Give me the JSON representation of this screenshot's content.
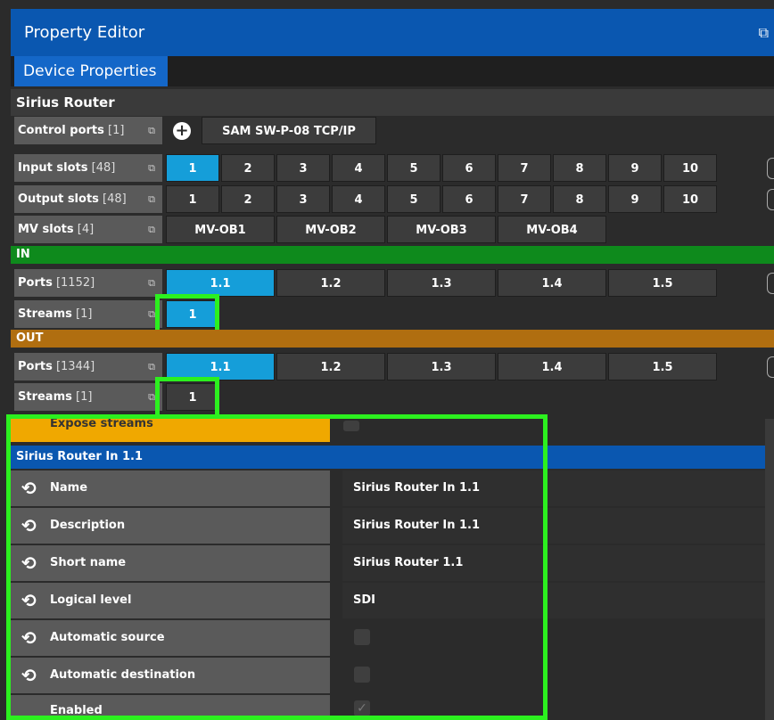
{
  "window": {
    "title": "Property Editor",
    "icon": "detach-icon"
  },
  "tabs": [
    {
      "label": "Device Properties"
    }
  ],
  "device": {
    "name": "Sirius Router"
  },
  "control_ports": {
    "label": "Control ports",
    "count": "[1]",
    "value": "SAM SW-P-08 TCP/IP"
  },
  "input_slots": {
    "label": "Input slots",
    "count": "[48]",
    "cells": [
      "1",
      "2",
      "3",
      "4",
      "5",
      "6",
      "7",
      "8",
      "9",
      "10"
    ],
    "selected": "1"
  },
  "output_slots": {
    "label": "Output slots",
    "count": "[48]",
    "cells": [
      "1",
      "2",
      "3",
      "4",
      "5",
      "6",
      "7",
      "8",
      "9",
      "10"
    ]
  },
  "mv_slots": {
    "label": "MV slots",
    "count": "[4]",
    "cells": [
      "MV-OB1",
      "MV-OB2",
      "MV-OB3",
      "MV-OB4"
    ]
  },
  "in_section": {
    "label": "IN",
    "ports": {
      "label": "Ports",
      "count": "[1152]",
      "cells": [
        "1.1",
        "1.2",
        "1.3",
        "1.4",
        "1.5"
      ],
      "selected": "1.1"
    },
    "streams": {
      "label": "Streams",
      "count": "[1]",
      "cells": [
        "1"
      ],
      "selected": "1"
    }
  },
  "out_section": {
    "label": "OUT",
    "ports": {
      "label": "Ports",
      "count": "[1344]",
      "cells": [
        "1.1",
        "1.2",
        "1.3",
        "1.4",
        "1.5"
      ],
      "selected": "1.1"
    },
    "streams": {
      "label": "Streams",
      "count": "[1]",
      "cells": [
        "1"
      ]
    }
  },
  "properties": {
    "expose_label": "Expose streams",
    "group": "Sirius Router In 1.1",
    "items": [
      {
        "label": "Name",
        "value": "Sirius Router In 1.1"
      },
      {
        "label": "Description",
        "value": "Sirius Router In 1.1"
      },
      {
        "label": "Short name",
        "value": "Sirius Router 1.1"
      },
      {
        "label": "Logical level",
        "value": "SDI"
      },
      {
        "label": "Automatic source",
        "value": ""
      },
      {
        "label": "Automatic destination",
        "value": ""
      },
      {
        "label": "Enabled",
        "value": ""
      }
    ]
  },
  "colors": {
    "title_blue": "#0a57b0",
    "tab_blue": "#1467c8",
    "selected_cell": "#159ed9",
    "in_green": "#0e8a1c",
    "out_orange": "#b06e10",
    "expose_yellow": "#f0a800",
    "highlight_green": "#2cf01f"
  }
}
